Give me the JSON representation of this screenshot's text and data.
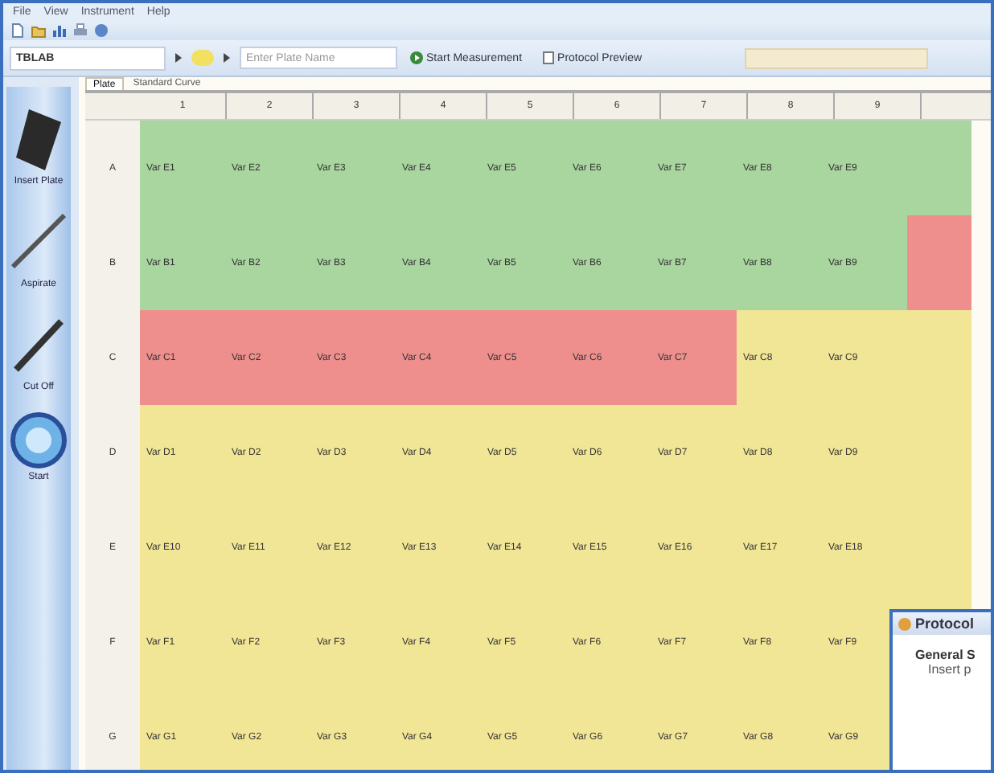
{
  "menu": [
    "File",
    "View",
    "Instrument",
    "Help"
  ],
  "toolbar": {
    "plate_combo": "TBLAB",
    "plate_name": {
      "placeholder": "Enter Plate Name"
    },
    "buttons": [
      "Start Measurement",
      "Protocol Preview"
    ]
  },
  "sidebar": {
    "items": [
      {
        "kind": "plate",
        "label": "Insert Plate"
      },
      {
        "kind": "pipette",
        "label": "Aspirate"
      },
      {
        "kind": "probe",
        "label": "Cut Off"
      },
      {
        "kind": "start",
        "label": "Start"
      }
    ]
  },
  "tabs": [
    {
      "label": "Plate",
      "selected": true
    },
    {
      "label": "Standard Curve",
      "selected": false
    }
  ],
  "plate": {
    "columns": [
      "1",
      "2",
      "3",
      "4",
      "5",
      "6",
      "7",
      "8",
      "9"
    ],
    "rows": [
      {
        "label": "A",
        "cells": [
          {
            "text": "Var E1",
            "color": "#a9d59f"
          },
          {
            "text": "Var E2",
            "color": "#a9d59f"
          },
          {
            "text": "Var E3",
            "color": "#a9d59f"
          },
          {
            "text": "Var E4",
            "color": "#a9d59f"
          },
          {
            "text": "Var E5",
            "color": "#a9d59f"
          },
          {
            "text": "Var E6",
            "color": "#a9d59f"
          },
          {
            "text": "Var E7",
            "color": "#a9d59f"
          },
          {
            "text": "Var E8",
            "color": "#a9d59f"
          },
          {
            "text": "Var E9",
            "color": "#a9d59f"
          },
          {
            "color": "#a9d59f"
          }
        ]
      },
      {
        "label": "B",
        "cells": [
          {
            "text": "Var B1",
            "color": "#a9d59f"
          },
          {
            "text": "Var B2",
            "color": "#a9d59f"
          },
          {
            "text": "Var B3",
            "color": "#a9d59f"
          },
          {
            "text": "Var B4",
            "color": "#a9d59f"
          },
          {
            "text": "Var B5",
            "color": "#a9d59f"
          },
          {
            "text": "Var B6",
            "color": "#a9d59f"
          },
          {
            "text": "Var B7",
            "color": "#a9d59f"
          },
          {
            "text": "Var B8",
            "color": "#a9d59f"
          },
          {
            "text": "Var B9",
            "color": "#a9d59f"
          },
          {
            "color": "#ee8f8d"
          }
        ]
      },
      {
        "label": "C",
        "cells": [
          {
            "text": "Var C1",
            "color": "#ee8f8d"
          },
          {
            "text": "Var C2",
            "color": "#ee8f8d"
          },
          {
            "text": "Var C3",
            "color": "#ee8f8d"
          },
          {
            "text": "Var C4",
            "color": "#ee8f8d"
          },
          {
            "text": "Var C5",
            "color": "#ee8f8d"
          },
          {
            "text": "Var C6",
            "color": "#ee8f8d"
          },
          {
            "text": "Var C7",
            "color": "#ee8f8d"
          },
          {
            "text": "Var C8",
            "color": "#f1e596"
          },
          {
            "text": "Var C9",
            "color": "#f1e596"
          },
          {
            "color": "#f1e596"
          }
        ]
      },
      {
        "label": "D",
        "cells": [
          {
            "text": "Var D1",
            "color": "#f1e596"
          },
          {
            "text": "Var D2",
            "color": "#f1e596"
          },
          {
            "text": "Var D3",
            "color": "#f1e596"
          },
          {
            "text": "Var D4",
            "color": "#f1e596"
          },
          {
            "text": "Var D5",
            "color": "#f1e596"
          },
          {
            "text": "Var D6",
            "color": "#f1e596"
          },
          {
            "text": "Var D7",
            "color": "#f1e596"
          },
          {
            "text": "Var D8",
            "color": "#f1e596"
          },
          {
            "text": "Var D9",
            "color": "#f1e596"
          },
          {
            "color": "#f1e596"
          }
        ]
      },
      {
        "label": "E",
        "cells": [
          {
            "text": "Var E10",
            "color": "#f1e596"
          },
          {
            "text": "Var E11",
            "color": "#f1e596"
          },
          {
            "text": "Var E12",
            "color": "#f1e596"
          },
          {
            "text": "Var E13",
            "color": "#f1e596"
          },
          {
            "text": "Var E14",
            "color": "#f1e596"
          },
          {
            "text": "Var E15",
            "color": "#f1e596"
          },
          {
            "text": "Var E16",
            "color": "#f1e596"
          },
          {
            "text": "Var E17",
            "color": "#f1e596"
          },
          {
            "text": "Var E18",
            "color": "#f1e596"
          },
          {
            "color": "#f1e596"
          }
        ]
      },
      {
        "label": "F",
        "cells": [
          {
            "text": "Var F1",
            "color": "#f1e596"
          },
          {
            "text": "Var F2",
            "color": "#f1e596"
          },
          {
            "text": "Var F3",
            "color": "#f1e596"
          },
          {
            "text": "Var F4",
            "color": "#f1e596"
          },
          {
            "text": "Var F5",
            "color": "#f1e596"
          },
          {
            "text": "Var F6",
            "color": "#f1e596"
          },
          {
            "text": "Var F7",
            "color": "#f1e596"
          },
          {
            "text": "Var F8",
            "color": "#f1e596"
          },
          {
            "text": "Var F9",
            "color": "#f1e596"
          },
          {
            "color": "#f1e596"
          }
        ]
      },
      {
        "label": "G",
        "cells": [
          {
            "text": "Var G1",
            "color": "#f1e596"
          },
          {
            "text": "Var G2",
            "color": "#f1e596"
          },
          {
            "text": "Var G3",
            "color": "#f1e596"
          },
          {
            "text": "Var G4",
            "color": "#f1e596"
          },
          {
            "text": "Var G5",
            "color": "#f1e596"
          },
          {
            "text": "Var G6",
            "color": "#f1e596"
          },
          {
            "text": "Var G7",
            "color": "#f1e596"
          },
          {
            "text": "Var G8",
            "color": "#f1e596"
          },
          {
            "text": "Var G9",
            "color": "#f1e596"
          }
        ]
      }
    ]
  },
  "dialog": {
    "title": "Protocol",
    "heading": "General S",
    "text": "Insert p"
  }
}
